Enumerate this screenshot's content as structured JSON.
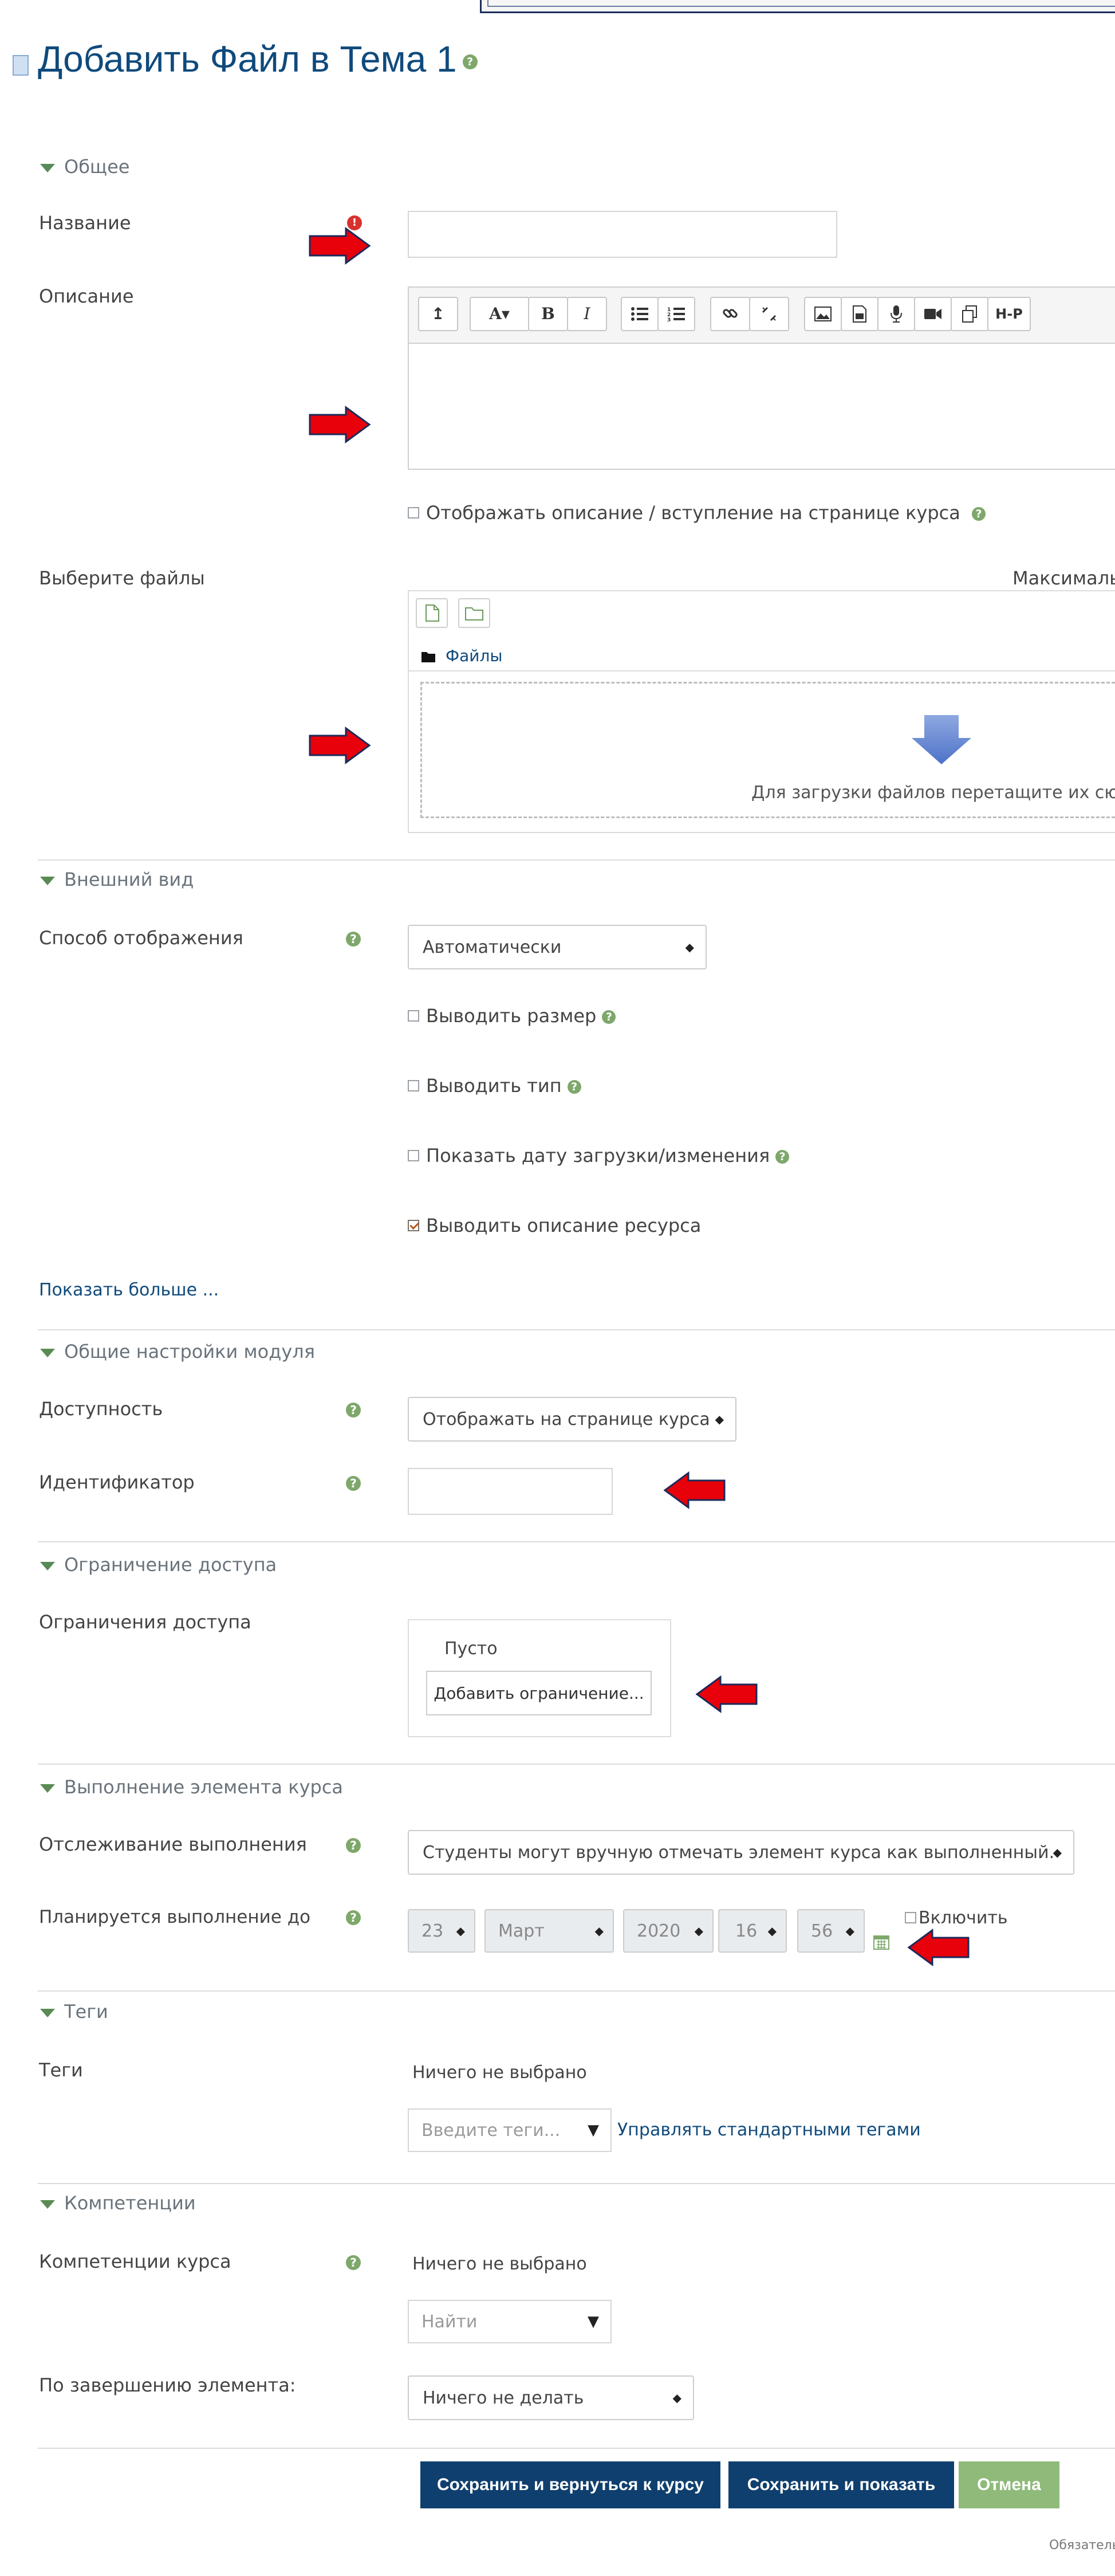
{
  "page": {
    "title": "Добавить Файл в Тема 1",
    "help": "?",
    "required_icon": "!"
  },
  "general": {
    "section": "Общее",
    "name_label": "Название",
    "name_value": "",
    "description_label": "Описание",
    "toolbar": [
      "↥",
      "A▾",
      "B",
      "I",
      "bullet-list-icon",
      "numbered-list-icon",
      "link-icon",
      "unlink-icon",
      "image-icon",
      "media-icon",
      "mic-icon",
      "video-icon",
      "copy-icon",
      "H-P"
    ],
    "show_description_label": "Отображать описание / вступление на странице курса",
    "files_label": "Выберите файлы",
    "max_size_text": "Максималь",
    "files_folder": "Файлы",
    "drop_text": "Для загрузки файлов перетащите их сюда"
  },
  "appearance": {
    "section": "Внешний вид",
    "display_label": "Способ отображения",
    "display_value": "Автоматически",
    "show_size": "Выводить размер",
    "show_type": "Выводить тип",
    "show_date": "Показать дату загрузки/изменения",
    "show_resource_desc": "Выводить описание ресурса",
    "show_resource_desc_checked": true,
    "show_more": "Показать больше ..."
  },
  "module": {
    "section": "Общие настройки модуля",
    "availability_label": "Доступность",
    "availability_value": "Отображать на странице курса",
    "id_label": "Идентификатор",
    "id_value": ""
  },
  "restrict": {
    "section": "Ограничение доступа",
    "label": "Ограничения доступа",
    "empty": "Пусто",
    "add_button": "Добавить ограничение..."
  },
  "completion": {
    "section": "Выполнение элемента курса",
    "tracking_label": "Отслеживание выполнения",
    "tracking_value": "Студенты могут вручную отмечать элемент курса как выполненный.",
    "expected_label": "Планируется выполнение до",
    "day": "23",
    "month": "Март",
    "year": "2020",
    "hour": "16",
    "minute": "56",
    "enable": "Включить"
  },
  "tags": {
    "section": "Теги",
    "label": "Теги",
    "none": "Ничего не выбрано",
    "placeholder": "Введите теги...",
    "manage": "Управлять стандартными тегами"
  },
  "competencies": {
    "section": "Компетенции",
    "label": "Компетенции курса",
    "none": "Ничего не выбрано",
    "search": "Найти",
    "on_completion_label": "По завершению элемента:",
    "on_completion_value": "Ничего не делать"
  },
  "buttons": {
    "save_return": "Сохранить и вернуться к курсу",
    "save_display": "Сохранить и показать",
    "cancel": "Отмена"
  },
  "footer": {
    "required_note": "Обязатель"
  },
  "colors": {
    "primary": "#0f4a7c",
    "cancel": "#8fba7a",
    "annotation_arrow": "#e8000b"
  }
}
